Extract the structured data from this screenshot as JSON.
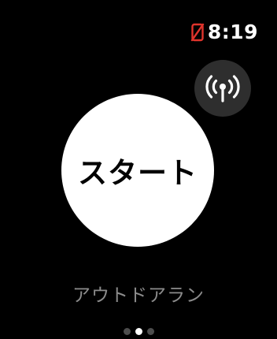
{
  "status_bar": {
    "time": "8:19",
    "connection_icon": "phone-disconnected-icon",
    "connection_color": "#e0342c"
  },
  "live_button": {
    "icon": "broadcast-icon"
  },
  "start_button": {
    "label": "スタート"
  },
  "workout": {
    "title": "アウトドアラン"
  },
  "pagination": {
    "count": 3,
    "current": 2
  },
  "colors": {
    "background": "#000000",
    "start_button": "#ffffff",
    "live_button": "#2e2e2e",
    "title_text": "#8c8c8c"
  }
}
